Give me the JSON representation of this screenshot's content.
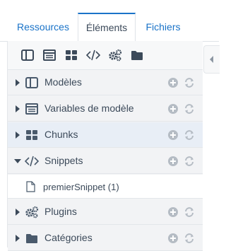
{
  "tabs": [
    {
      "label": "Ressources"
    },
    {
      "label": "Éléments"
    },
    {
      "label": "Fichiers"
    }
  ],
  "active_tab": "Éléments",
  "toolbar": {
    "icons": [
      "template-icon",
      "tv-icon",
      "chunk-icon",
      "snippet-icon",
      "plugin-icon",
      "folder-icon"
    ]
  },
  "tree": [
    {
      "label": "Modèles",
      "icon": "template-icon",
      "expanded": false
    },
    {
      "label": "Variables de modèle",
      "icon": "tv-icon",
      "expanded": false
    },
    {
      "label": "Chunks",
      "icon": "chunk-icon",
      "expanded": false
    },
    {
      "label": "Snippets",
      "icon": "snippet-icon",
      "expanded": true,
      "children": [
        {
          "label": "premierSnippet (1)",
          "icon": "file-icon"
        }
      ]
    },
    {
      "label": "Plugins",
      "icon": "plugin-icon",
      "expanded": false
    },
    {
      "label": "Catégories",
      "icon": "folder-icon",
      "expanded": false
    }
  ],
  "colors": {
    "accent": "#1a73c8",
    "icon": "#4a5a6c",
    "action": "#b5bcc4",
    "highlight": "#e8eef6"
  }
}
